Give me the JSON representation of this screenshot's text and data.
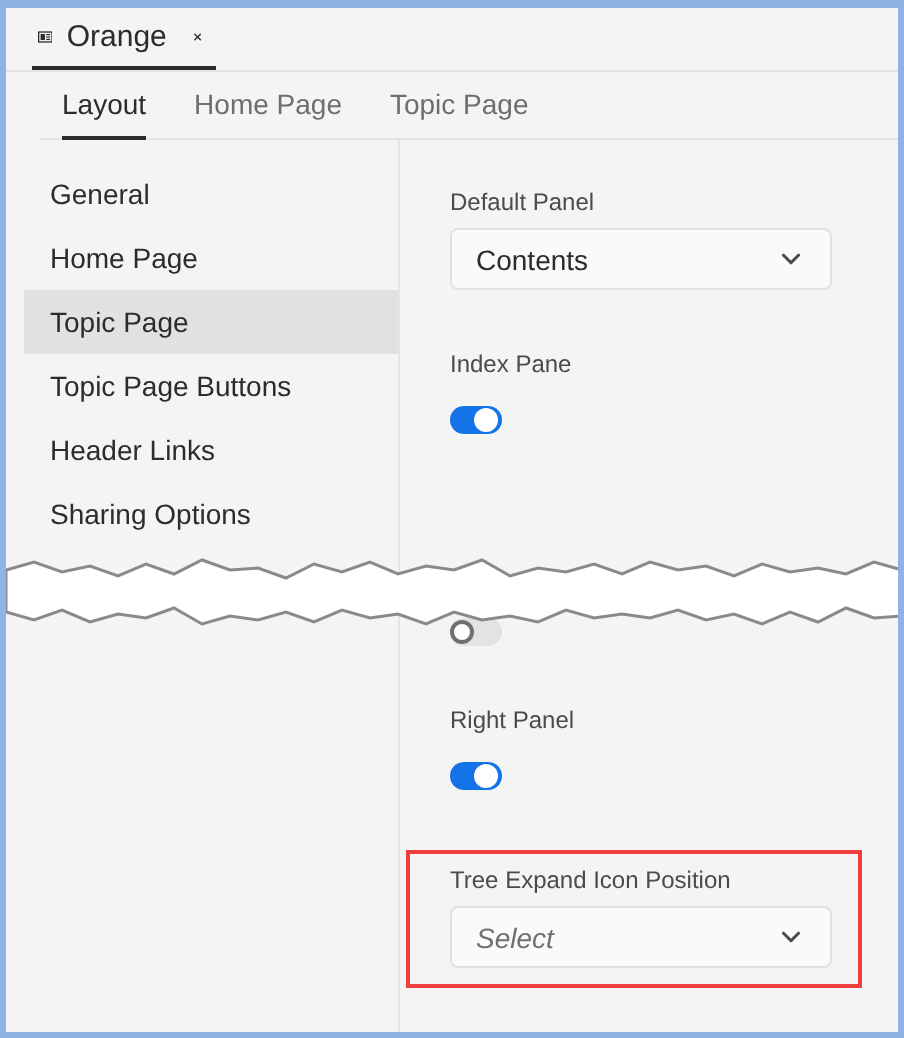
{
  "document_tab": {
    "title": "Orange"
  },
  "tabs": [
    {
      "label": "Layout",
      "selected": true
    },
    {
      "label": "Home Page",
      "selected": false
    },
    {
      "label": "Topic Page",
      "selected": false
    }
  ],
  "sidebar": {
    "items": [
      {
        "label": "General",
        "selected": false
      },
      {
        "label": "Home Page",
        "selected": false
      },
      {
        "label": "Topic Page",
        "selected": true
      },
      {
        "label": "Topic Page Buttons",
        "selected": false
      },
      {
        "label": "Header Links",
        "selected": false
      },
      {
        "label": "Sharing Options",
        "selected": false
      }
    ]
  },
  "settings": [
    {
      "kind": "dropdown",
      "label": "Default Panel",
      "value": "Contents",
      "highlighted": false
    },
    {
      "kind": "toggle",
      "label": "Index Pane",
      "on": true
    },
    {
      "kind": "toggle",
      "on": false
    },
    {
      "kind": "toggle",
      "label": "Right Panel",
      "on": true
    },
    {
      "kind": "dropdown",
      "label": "Tree Expand Icon Position",
      "placeholder": "Select",
      "highlighted": true
    }
  ]
}
